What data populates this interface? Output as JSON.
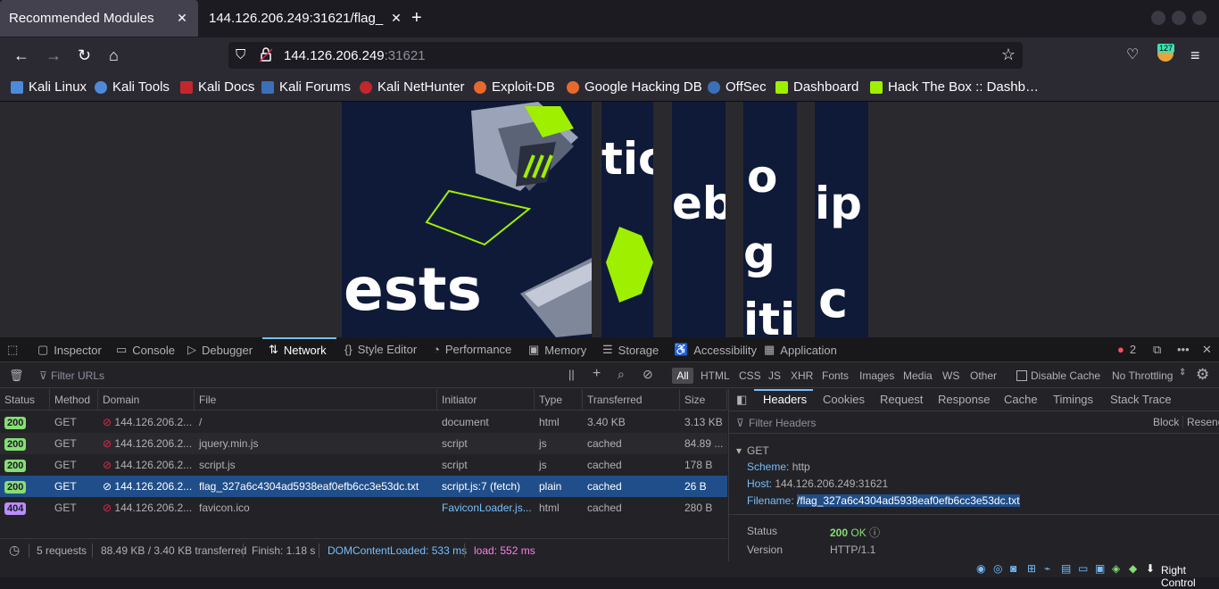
{
  "tabs": [
    {
      "label": "Recommended Modules"
    },
    {
      "label": "144.126.206.249:31621/flag_"
    }
  ],
  "url": {
    "host": "144.126.206.249",
    "port": ":31621"
  },
  "extension_badge": "127",
  "bookmarks": [
    {
      "label": "Kali Linux",
      "color": "#4d8ad9"
    },
    {
      "label": "Kali Tools",
      "color": "#4d8ad9"
    },
    {
      "label": "Kali Docs",
      "color": "#c2272d"
    },
    {
      "label": "Kali Forums",
      "color": "#3b6fb6"
    },
    {
      "label": "Kali NetHunter",
      "color": "#c2272d"
    },
    {
      "label": "Exploit-DB",
      "color": "#e8692b"
    },
    {
      "label": "Google Hacking DB",
      "color": "#e8692b"
    },
    {
      "label": "OffSec",
      "color": "#3b6fb6"
    },
    {
      "label": "Dashboard",
      "color": "#9fef00"
    },
    {
      "label": "Hack The Box :: Dashb…",
      "color": "#9fef00"
    }
  ],
  "page_words": [
    "ests",
    "tic",
    "eb",
    "o",
    "g",
    "iti",
    "ip",
    "c"
  ],
  "devtools": {
    "tabs": [
      "Inspector",
      "Console",
      "Debugger",
      "Network",
      "Style Editor",
      "Performance",
      "Memory",
      "Storage",
      "Accessibility",
      "Application"
    ],
    "error_count": "2",
    "filter_placeholder": "Filter URLs",
    "type_filters": [
      "All",
      "HTML",
      "CSS",
      "JS",
      "XHR",
      "Fonts",
      "Images",
      "Media",
      "WS",
      "Other"
    ],
    "disable_cache": "Disable Cache",
    "throttling": "No Throttling",
    "columns": [
      "Status",
      "Method",
      "Domain",
      "File",
      "Initiator",
      "Type",
      "Transferred",
      "Size"
    ],
    "rows": [
      {
        "status": "200",
        "method": "GET",
        "domain": "144.126.206.2...",
        "file": "/",
        "initiator": "document",
        "type": "html",
        "transferred": "3.40 KB",
        "size": "3.13 KB"
      },
      {
        "status": "200",
        "method": "GET",
        "domain": "144.126.206.2...",
        "file": "jquery.min.js",
        "initiator": "script",
        "type": "js",
        "transferred": "cached",
        "size": "84.89 ..."
      },
      {
        "status": "200",
        "method": "GET",
        "domain": "144.126.206.2...",
        "file": "script.js",
        "initiator": "script",
        "type": "js",
        "transferred": "cached",
        "size": "178 B"
      },
      {
        "status": "200",
        "method": "GET",
        "domain": "144.126.206.2...",
        "file": "flag_327a6c4304ad5938eaf0efb6cc3e53dc.txt",
        "initiator": "script.js:7 (fetch)",
        "type": "plain",
        "transferred": "cached",
        "size": "26 B"
      },
      {
        "status": "404",
        "method": "GET",
        "domain": "144.126.206.2...",
        "file": "favicon.ico",
        "initiator": "FaviconLoader.js...",
        "type": "html",
        "transferred": "cached",
        "size": "280 B"
      }
    ],
    "summary": {
      "requests": "5 requests",
      "transferred": "88.49 KB / 3.40 KB transferred",
      "finish": "Finish: 1.18 s",
      "dcl": "DOMContentLoaded: 533 ms",
      "load": "load: 552 ms"
    },
    "side_tabs": [
      "Headers",
      "Cookies",
      "Request",
      "Response",
      "Cache",
      "Timings",
      "Stack Trace"
    ],
    "filter_headers": "Filter Headers",
    "block": "Block",
    "resend": "Resend",
    "headers": {
      "method": "GET",
      "scheme_k": "Scheme:",
      "scheme_v": "http",
      "host_k": "Host:",
      "host_v": "144.126.206.249:31621",
      "filename_k": "Filename:",
      "filename_v": "/flag_327a6c4304ad5938eaf0efb6cc3e53dc.txt",
      "status_k": "Status",
      "status_code": "200",
      "status_text": "OK",
      "version_k": "Version",
      "version_v": "HTTP/1.1"
    }
  },
  "taskbar_label": "Right Control"
}
